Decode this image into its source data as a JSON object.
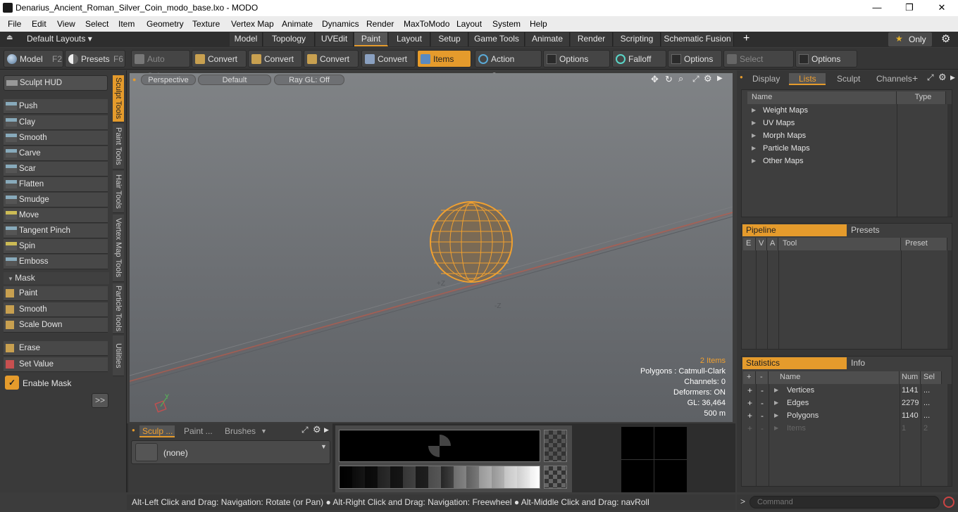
{
  "window": {
    "title": "Denarius_Ancient_Roman_Silver_Coin_modo_base.lxo - MODO",
    "minimize": "—",
    "maximize": "❐",
    "close": "✕"
  },
  "menu": [
    "File",
    "Edit",
    "View",
    "Select",
    "Item",
    "Geometry",
    "Texture",
    "Vertex Map",
    "Animate",
    "Dynamics",
    "Render",
    "MaxToModo",
    "Layout",
    "System",
    "Help"
  ],
  "layoutbar": {
    "layouts_label": "Default Layouts ▾",
    "tabs": [
      "Model",
      "Topology",
      "UVEdit",
      "Paint",
      "Layout",
      "Setup",
      "Game Tools",
      "Animate",
      "Render",
      "Scripting",
      "Schematic Fusion"
    ],
    "active_tab": "Paint",
    "add": "+",
    "only_label": "Only",
    "star": "★"
  },
  "toolbar": {
    "model": "Model",
    "model_key": "F2",
    "presets": "Presets",
    "presets_key": "F6",
    "auto_select": "Auto Select",
    "convert1": "Convert",
    "convert2": "Convert",
    "convert3": "Convert",
    "convert4": "Convert",
    "items": "Items",
    "action_center": "Action Center",
    "options1": "Options",
    "falloff": "Falloff",
    "options2": "Options",
    "select_through": "Select Through",
    "options3": "Options"
  },
  "leftpanel": {
    "sculpt_hud": "Sculpt HUD",
    "sculpt_tools": [
      "Push",
      "Clay",
      "Smooth",
      "Carve",
      "Scar",
      "Flatten",
      "Smudge",
      "Move",
      "Tangent Pinch",
      "Spin",
      "Emboss"
    ],
    "mask_header": "Mask",
    "mask_tools": [
      "Paint",
      "Smooth",
      "Scale Down"
    ],
    "erase": "Erase",
    "set_value": "Set Value",
    "enable_mask": "Enable Mask",
    "more": ">>",
    "side_tabs": [
      "Sculpt Tools",
      "Paint Tools",
      "Hair Tools",
      "Vertex Map Tools",
      "Particle Tools",
      "Utilities"
    ]
  },
  "viewport": {
    "view": "Perspective",
    "shading": "Default",
    "raygl": "Ray GL: Off",
    "axis_z1": "+Z",
    "axis_z2": "-Z",
    "axis_y": "Y",
    "info": {
      "items": "2 Items",
      "polygons": "Polygons : Catmull-Clark",
      "channels": "Channels: 0",
      "deformers": "Deformers: ON",
      "gl": "GL: 36,464",
      "scale": "500 m"
    },
    "colors": {
      "selection": "#e59b2c"
    }
  },
  "rightpanel": {
    "tabs": [
      "Display",
      "Lists",
      "Sculpt",
      "Channels"
    ],
    "active_tab": "Lists",
    "lists": {
      "col_name": "Name",
      "col_type": "Type",
      "rows": [
        "Weight Maps",
        "UV Maps",
        "Morph Maps",
        "Particle Maps",
        "Other Maps"
      ]
    },
    "pipeline": {
      "tab1": "Pipeline",
      "tab2": "Presets",
      "cols": [
        "E",
        "V",
        "A",
        "Tool",
        "Preset"
      ]
    },
    "statistics": {
      "tab1": "Statistics",
      "tab2": "Info",
      "cols": {
        "plus": "+",
        "minus": "-",
        "name": "Name",
        "num": "Num",
        "sel": "Sel"
      },
      "rows": [
        {
          "name": "Vertices",
          "num": "1141",
          "sel": "..."
        },
        {
          "name": "Edges",
          "num": "2279",
          "sel": "..."
        },
        {
          "name": "Polygons",
          "num": "1140",
          "sel": "..."
        },
        {
          "name": "Items",
          "num": "1",
          "sel": "2"
        }
      ]
    }
  },
  "bottom": {
    "tabs": [
      "Sculp ...",
      "Paint ...",
      "Brushes"
    ],
    "brush_value": "(none)"
  },
  "statusbar": {
    "text": "Alt-Left Click and Drag: Navigation: Rotate (or Pan) ● Alt-Right Click and Drag: Navigation: Freewheel ● Alt-Middle Click and Drag: navRoll"
  },
  "command": {
    "prompt": ">",
    "placeholder": "Command"
  }
}
